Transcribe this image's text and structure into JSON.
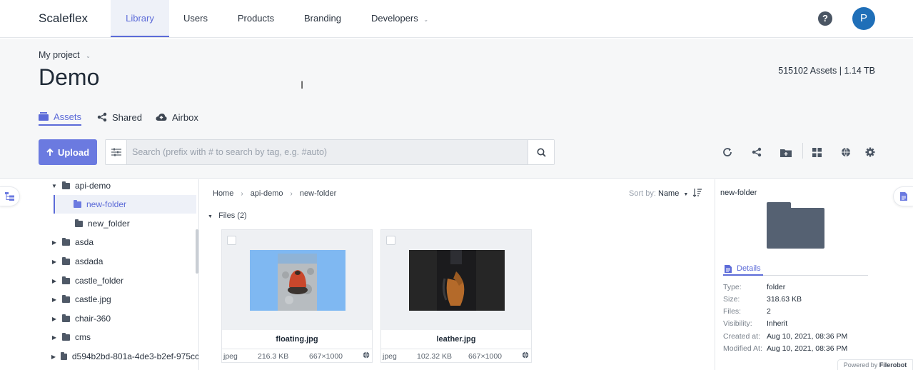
{
  "nav": {
    "brand": "Scaleflex",
    "tabs": [
      {
        "label": "Library",
        "active": true
      },
      {
        "label": "Users",
        "active": false
      },
      {
        "label": "Products",
        "active": false
      },
      {
        "label": "Branding",
        "active": false
      },
      {
        "label": "Developers",
        "active": false,
        "has_dropdown": true
      }
    ],
    "help_icon": "?",
    "avatar_initial": "P",
    "accent_color": "#5c6bd8",
    "avatar_color": "#1f6fb8"
  },
  "header": {
    "project": "My project",
    "title": "Demo",
    "stats": "515102 Assets | 1.14 TB",
    "subtabs": [
      {
        "label": "Assets",
        "icon": "drawer-icon",
        "active": true
      },
      {
        "label": "Shared",
        "icon": "share-icon",
        "active": false
      },
      {
        "label": "Airbox",
        "icon": "cloud-upload-icon",
        "active": false
      }
    ],
    "upload_label": "Upload",
    "search_placeholder": "Search (prefix with # to search by tag, e.g. #auto)",
    "toolbar_icons": [
      "refresh-icon",
      "share-icon",
      "new-folder-icon",
      "grid-view-icon",
      "globe-icon",
      "settings-icon"
    ]
  },
  "tree": {
    "items": [
      {
        "label": "api-demo",
        "expanded": true,
        "selected": false
      },
      {
        "label": "new-folder",
        "expanded": false,
        "selected": true
      },
      {
        "label": "new_folder",
        "expanded": false,
        "selected": false
      },
      {
        "label": "asda",
        "expanded": false,
        "selected": false
      },
      {
        "label": "asdada",
        "expanded": false,
        "selected": false
      },
      {
        "label": "castle_folder",
        "expanded": false,
        "selected": false
      },
      {
        "label": "castle.jpg",
        "expanded": false,
        "selected": false
      },
      {
        "label": "chair-360",
        "expanded": false,
        "selected": false
      },
      {
        "label": "cms",
        "expanded": false,
        "selected": false
      },
      {
        "label": "d594b2bd-801a-4de3-b2ef-975cc",
        "expanded": false,
        "selected": false
      }
    ]
  },
  "main": {
    "breadcrumb": [
      "Home",
      "api-demo",
      "new-folder"
    ],
    "sort_label": "Sort by:",
    "sort_value": "Name",
    "files_header": "Files (2)",
    "files": [
      {
        "name": "floating.jpg",
        "type": "jpeg",
        "size": "216.3 KB",
        "dimensions": "667×1000"
      },
      {
        "name": "leather.jpg",
        "type": "jpeg",
        "size": "102.32 KB",
        "dimensions": "667×1000"
      }
    ]
  },
  "details": {
    "title": "new-folder",
    "tab_label": "Details",
    "props": [
      {
        "key": "Type:",
        "value": "folder"
      },
      {
        "key": "Size:",
        "value": "318.63 KB"
      },
      {
        "key": "Files:",
        "value": "2"
      },
      {
        "key": "Visibility:",
        "value": "Inherit"
      },
      {
        "key": "Created at:",
        "value": "Aug 10, 2021, 08:36 PM"
      },
      {
        "key": "Modified At:",
        "value": "Aug 10, 2021, 08:36 PM"
      }
    ]
  },
  "footer": {
    "powered_prefix": "Powered by",
    "powered_brand": "Filerobot"
  }
}
